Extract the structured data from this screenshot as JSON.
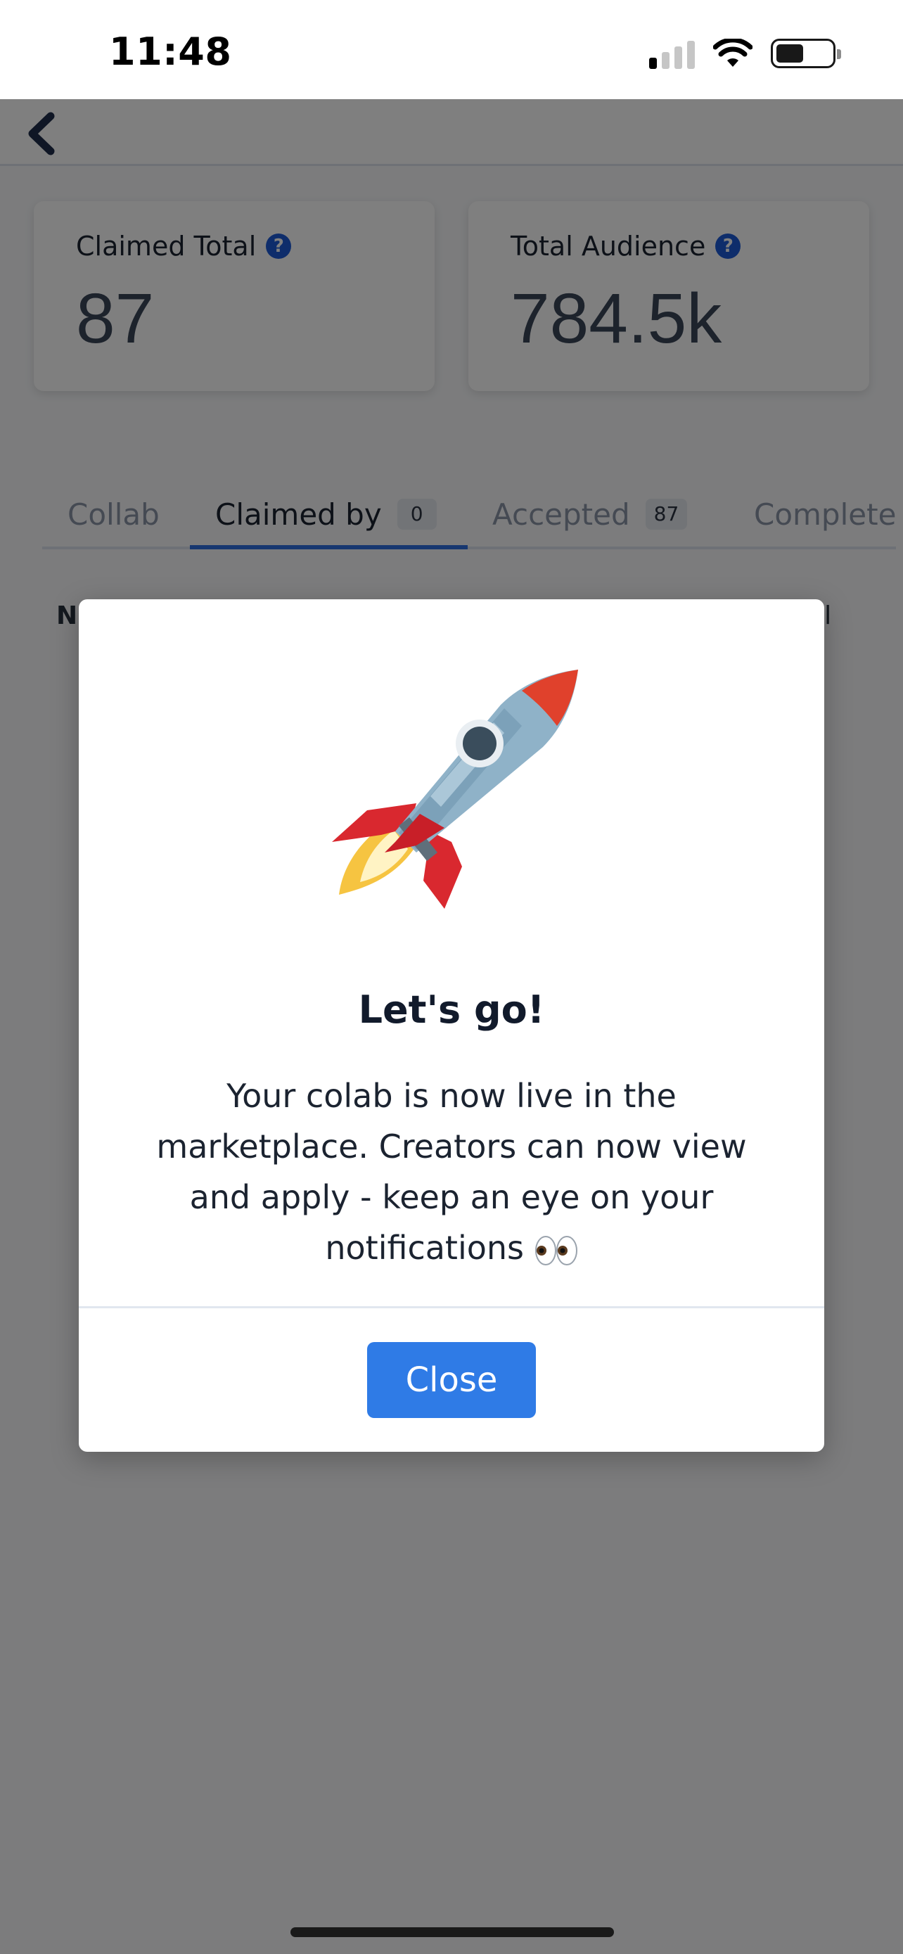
{
  "status_bar": {
    "time": "11:48",
    "icons": [
      "cellular-signal-icon",
      "wifi-icon",
      "battery-icon"
    ]
  },
  "header": {
    "back_icon": "chevron-left-icon"
  },
  "stats": [
    {
      "label": "Claimed Total",
      "value": "87",
      "icon": "help-circle-icon"
    },
    {
      "label": "Total Audience",
      "value": "784.5k",
      "icon": "help-circle-icon"
    }
  ],
  "tabs": [
    {
      "label": "Collab"
    },
    {
      "label": "Claimed by",
      "badge": "0",
      "active": true
    },
    {
      "label": "Accepted",
      "badge": "87"
    },
    {
      "label": "Complete"
    }
  ],
  "table": {
    "col_left_partial": "N",
    "col_right_partial": "ail"
  },
  "modal": {
    "icon": "rocket-icon",
    "title": "Let's go!",
    "body": "Your colab is now live in the marketplace. Creators can now view and apply - keep an eye on your notifications",
    "body_icon": "eyes-icon",
    "close_label": "Close"
  },
  "colors": {
    "accent": "#2f7be6",
    "tab_active_underline": "#2f6fe0",
    "help_icon": "#1d5bd6",
    "overlay": "rgba(0,0,0,0.5)"
  }
}
